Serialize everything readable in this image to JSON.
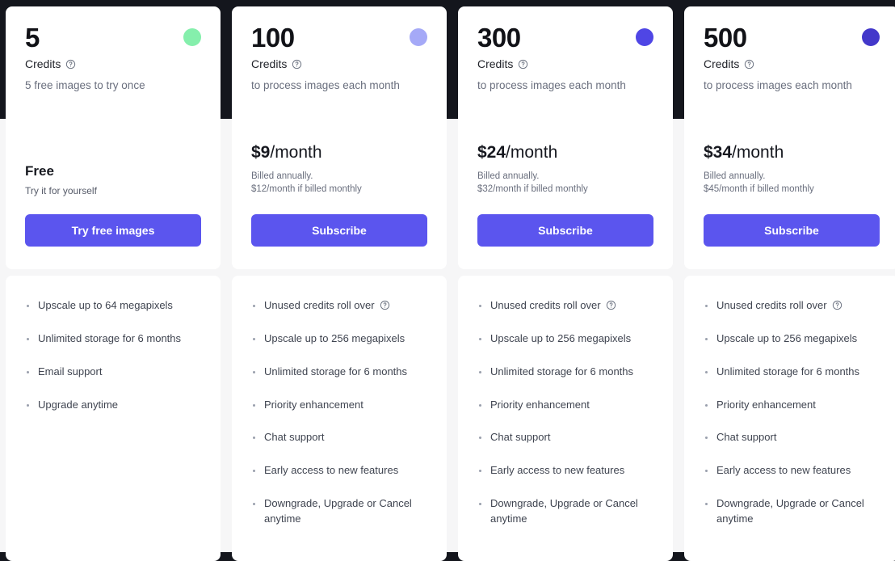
{
  "theme": {
    "hero_band_color": "#14161d",
    "page_background": "#f6f6f7",
    "card_background": "#ffffff",
    "accent_button_color": "#5b55ee",
    "bullet_color": "#9aa0ad"
  },
  "icons": {
    "info": "info-circle-icon"
  },
  "plans": [
    {
      "credits_amount": "5",
      "credits_label": "Credits",
      "credits_info_icon": "info-circle-icon",
      "dot_color": "#85efac",
      "tagline": "5 free images to try once",
      "price_title": "Free",
      "price_subtitle": "Try it for yourself",
      "price_main_amount": "",
      "price_main_period": "",
      "price_note_line1": "",
      "price_note_line2": "",
      "cta_label": "Try free images",
      "features": [
        {
          "text": "Upscale up to 64 megapixels",
          "has_info": false
        },
        {
          "text": "Unlimited storage for 6 months",
          "has_info": false
        },
        {
          "text": "Email support",
          "has_info": false
        },
        {
          "text": "Upgrade anytime",
          "has_info": false
        }
      ]
    },
    {
      "credits_amount": "100",
      "credits_label": "Credits",
      "credits_info_icon": "info-circle-icon",
      "dot_color": "#a5a9f7",
      "tagline": "to process images each month",
      "price_title": "",
      "price_subtitle": "",
      "price_main_amount": "$9",
      "price_main_period": "/month",
      "price_note_line1": "Billed annually.",
      "price_note_line2": "$12/month if billed monthly",
      "cta_label": "Subscribe",
      "features": [
        {
          "text": "Unused credits roll over",
          "has_info": true
        },
        {
          "text": "Upscale up to 256 megapixels",
          "has_info": false
        },
        {
          "text": "Unlimited storage for 6 months",
          "has_info": false
        },
        {
          "text": "Priority enhancement",
          "has_info": false
        },
        {
          "text": "Chat support",
          "has_info": false
        },
        {
          "text": "Early access to new features",
          "has_info": false
        },
        {
          "text": "Downgrade, Upgrade or Cancel anytime",
          "has_info": false
        }
      ]
    },
    {
      "credits_amount": "300",
      "credits_label": "Credits",
      "credits_info_icon": "info-circle-icon",
      "dot_color": "#4f46e5",
      "tagline": "to process images each month",
      "price_title": "",
      "price_subtitle": "",
      "price_main_amount": "$24",
      "price_main_period": "/month",
      "price_note_line1": "Billed annually.",
      "price_note_line2": "$32/month if billed monthly",
      "cta_label": "Subscribe",
      "features": [
        {
          "text": "Unused credits roll over",
          "has_info": true
        },
        {
          "text": "Upscale up to 256 megapixels",
          "has_info": false
        },
        {
          "text": "Unlimited storage for 6 months",
          "has_info": false
        },
        {
          "text": "Priority enhancement",
          "has_info": false
        },
        {
          "text": "Chat support",
          "has_info": false
        },
        {
          "text": "Early access to new features",
          "has_info": false
        },
        {
          "text": "Downgrade, Upgrade or Cancel anytime",
          "has_info": false
        }
      ]
    },
    {
      "credits_amount": "500",
      "credits_label": "Credits",
      "credits_info_icon": "info-circle-icon",
      "dot_color": "#4338ca",
      "tagline": "to process images each month",
      "price_title": "",
      "price_subtitle": "",
      "price_main_amount": "$34",
      "price_main_period": "/month",
      "price_note_line1": "Billed annually.",
      "price_note_line2": "$45/month if billed monthly",
      "cta_label": "Subscribe",
      "features": [
        {
          "text": "Unused credits roll over",
          "has_info": true
        },
        {
          "text": "Upscale up to 256 megapixels",
          "has_info": false
        },
        {
          "text": "Unlimited storage for 6 months",
          "has_info": false
        },
        {
          "text": "Priority enhancement",
          "has_info": false
        },
        {
          "text": "Chat support",
          "has_info": false
        },
        {
          "text": "Early access to new features",
          "has_info": false
        },
        {
          "text": "Downgrade, Upgrade or Cancel anytime",
          "has_info": false
        }
      ]
    }
  ]
}
